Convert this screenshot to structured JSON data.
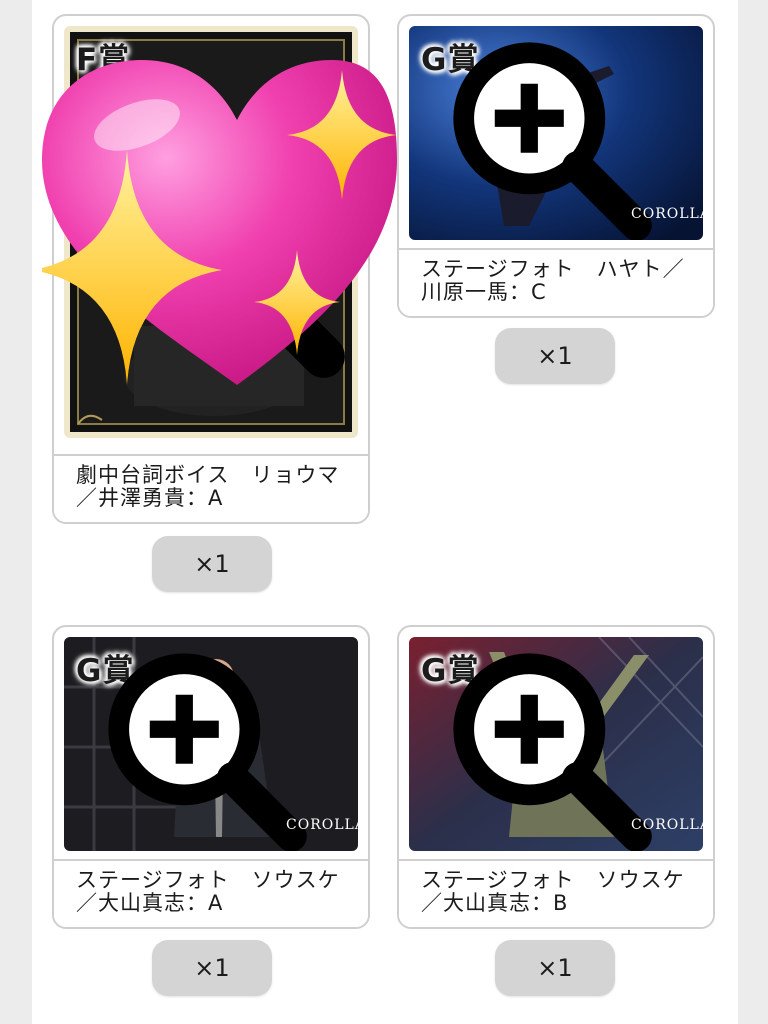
{
  "items": [
    {
      "rank": "F賞",
      "name": "劇中台詞ボイス　リョウマ／井澤勇貴：A",
      "qty": "×1",
      "logo": ""
    },
    {
      "rank": "G賞",
      "name": "ステージフォト　ハヤト／川原一馬：C",
      "qty": "×1",
      "logo": "COROLLA"
    },
    {
      "rank": "G賞",
      "name": "ステージフォト　ソウスケ／大山真志：A",
      "qty": "×1",
      "logo": "COROLLA"
    },
    {
      "rank": "G賞",
      "name": "ステージフォト　ソウスケ／大山真志：B",
      "qty": "×1",
      "logo": "COROLLA"
    }
  ],
  "icons": {
    "zoom": "zoom-in-icon",
    "overlay": "sparkling-heart-emoji"
  },
  "colors": {
    "heart": "#f03fae",
    "sparkle": "#ffc61a",
    "card_border": "#cfcfcf",
    "qty_bg": "#d4d4d4"
  }
}
